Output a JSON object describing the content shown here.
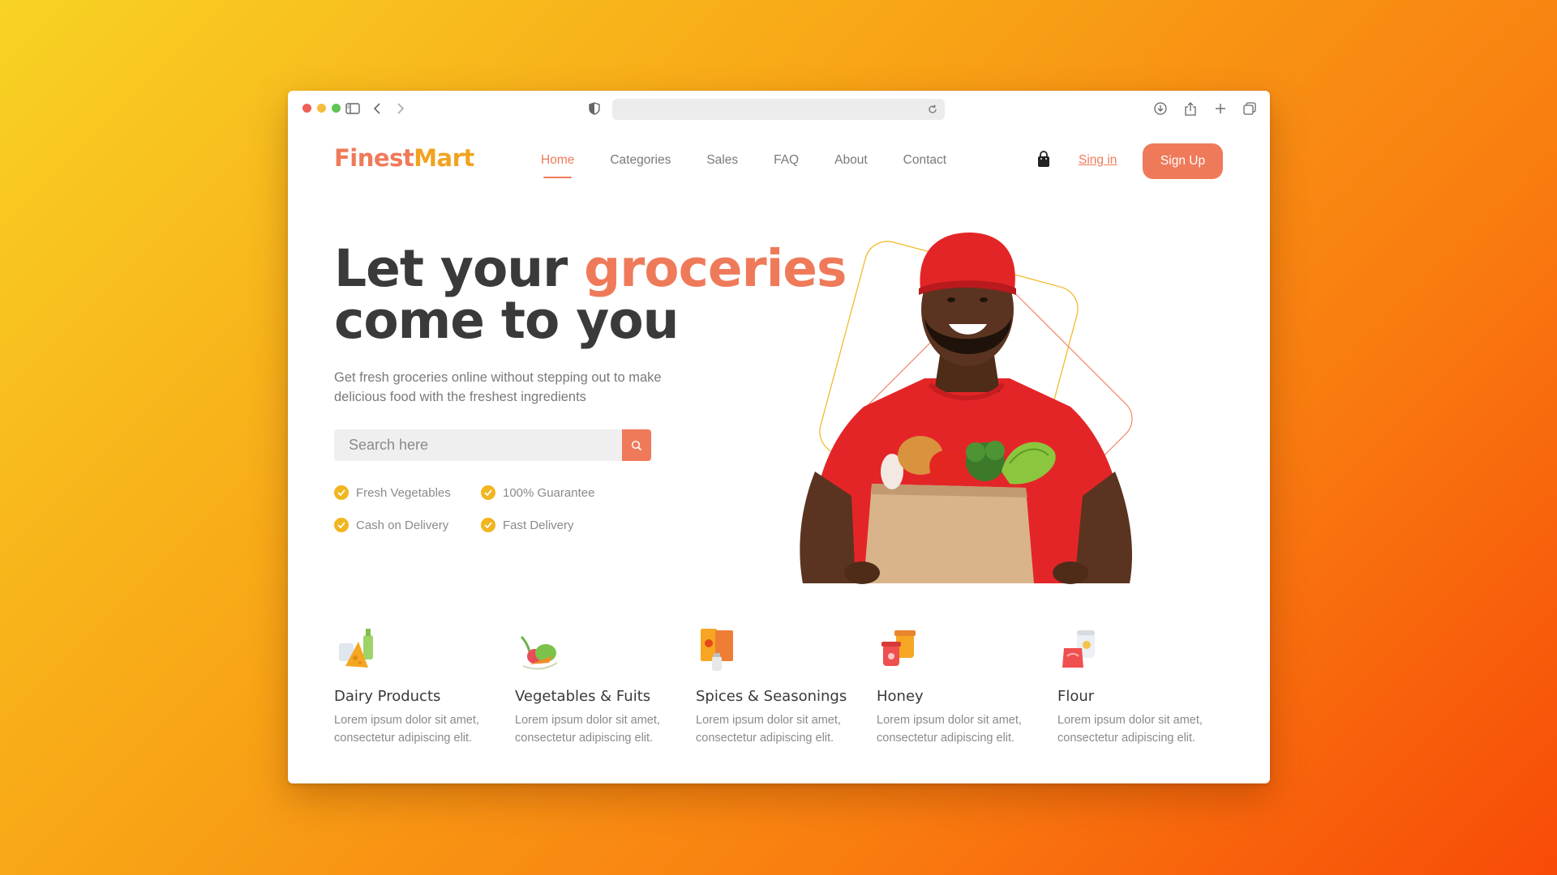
{
  "browser": {
    "url": "",
    "icons": [
      "sidebar-icon",
      "back-icon",
      "forward-icon",
      "shield-icon",
      "reload-icon",
      "download-icon",
      "share-icon",
      "new-tab-icon",
      "tabs-overview-icon"
    ]
  },
  "brand": {
    "name_part1": "Finest",
    "name_part2": "Mart",
    "color1": "#ef7a5a",
    "color2": "#f1a320"
  },
  "nav": {
    "items": [
      {
        "label": "Home",
        "active": true
      },
      {
        "label": "Categories"
      },
      {
        "label": "Sales"
      },
      {
        "label": "FAQ"
      },
      {
        "label": "About"
      },
      {
        "label": "Contact"
      }
    ],
    "cart_icon": "shopping-bag-icon",
    "signin_label": "Sing in",
    "signup_label": "Sign Up"
  },
  "hero": {
    "title_part1": "Let your ",
    "title_accent": "groceries",
    "title_part2": "come to you",
    "subtitle": "Get fresh groceries online without stepping out to make delicious food with the freshest ingredients",
    "search_placeholder": "Search here",
    "features": [
      "Fresh Vegetables",
      "100% Guarantee",
      "Cash on Delivery",
      "Fast Delivery"
    ]
  },
  "categories": [
    {
      "title": "Dairy Products",
      "desc": "Lorem ipsum dolor sit amet, consectetur adipiscing elit.",
      "icon": "dairy-icon"
    },
    {
      "title": "Vegetables & Fuits",
      "desc": "Lorem ipsum dolor sit amet, consectetur adipiscing elit.",
      "icon": "vegetables-icon"
    },
    {
      "title": "Spices & Seasonings",
      "desc": "Lorem ipsum dolor sit amet, consectetur adipiscing elit.",
      "icon": "spices-icon"
    },
    {
      "title": "Honey",
      "desc": "Lorem ipsum dolor sit amet, consectetur adipiscing elit.",
      "icon": "honey-icon"
    },
    {
      "title": "Flour",
      "desc": "Lorem ipsum dolor sit amet, consectetur adipiscing elit.",
      "icon": "flour-icon"
    }
  ],
  "colors": {
    "accent": "#ef7a5a",
    "check": "#f1b51f",
    "text_dark": "#3a3a3a",
    "text_muted": "#7a7a7a"
  }
}
